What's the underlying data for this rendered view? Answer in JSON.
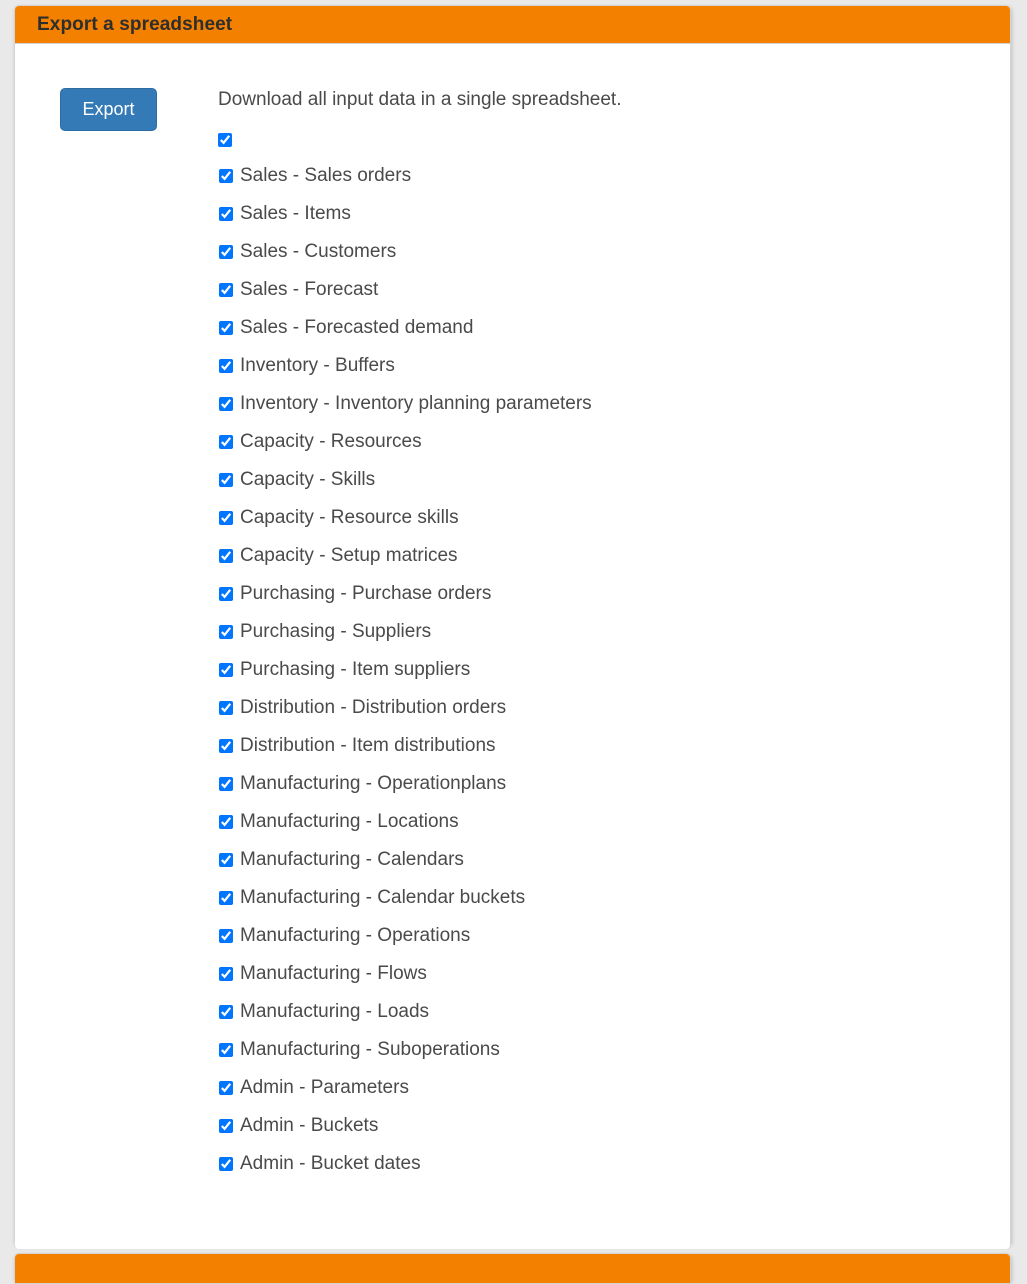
{
  "page": {
    "background_color": "#e9e9e9"
  },
  "panel": {
    "title": "Export a spreadsheet",
    "header_color": "#f48000",
    "body_color": "#ffffff"
  },
  "export": {
    "button_label": "Export",
    "button_color": "#337ab7",
    "description": "Download all input data in a single spreadsheet."
  },
  "select_all": {
    "label": "",
    "checked": true
  },
  "checklist": [
    {
      "label": "Sales - Sales orders",
      "checked": true
    },
    {
      "label": "Sales - Items",
      "checked": true
    },
    {
      "label": "Sales - Customers",
      "checked": true
    },
    {
      "label": "Sales - Forecast",
      "checked": true
    },
    {
      "label": "Sales - Forecasted demand",
      "checked": true
    },
    {
      "label": "Inventory - Buffers",
      "checked": true
    },
    {
      "label": "Inventory - Inventory planning parameters",
      "checked": true
    },
    {
      "label": "Capacity - Resources",
      "checked": true
    },
    {
      "label": "Capacity - Skills",
      "checked": true
    },
    {
      "label": "Capacity - Resource skills",
      "checked": true
    },
    {
      "label": "Capacity - Setup matrices",
      "checked": true
    },
    {
      "label": "Purchasing - Purchase orders",
      "checked": true
    },
    {
      "label": "Purchasing - Suppliers",
      "checked": true
    },
    {
      "label": "Purchasing - Item suppliers",
      "checked": true
    },
    {
      "label": "Distribution - Distribution orders",
      "checked": true
    },
    {
      "label": "Distribution - Item distributions",
      "checked": true
    },
    {
      "label": "Manufacturing - Operationplans",
      "checked": true
    },
    {
      "label": "Manufacturing - Locations",
      "checked": true
    },
    {
      "label": "Manufacturing - Calendars",
      "checked": true
    },
    {
      "label": "Manufacturing - Calendar buckets",
      "checked": true
    },
    {
      "label": "Manufacturing - Operations",
      "checked": true
    },
    {
      "label": "Manufacturing - Flows",
      "checked": true
    },
    {
      "label": "Manufacturing - Loads",
      "checked": true
    },
    {
      "label": "Manufacturing - Suboperations",
      "checked": true
    },
    {
      "label": "Admin - Parameters",
      "checked": true
    },
    {
      "label": "Admin - Buckets",
      "checked": true
    },
    {
      "label": "Admin - Bucket dates",
      "checked": true
    }
  ],
  "next_panel": {
    "title": ""
  }
}
